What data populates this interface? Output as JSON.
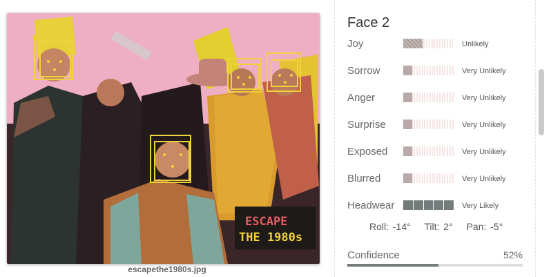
{
  "image": {
    "filename": "escapethe1980s.jpg",
    "sign": {
      "line1": "ESCAPE",
      "line2": "THE 1980s"
    }
  },
  "face": {
    "title": "Face 2",
    "attributes": [
      {
        "label": "Joy",
        "value": "Unlikely",
        "level": 1,
        "max": 5,
        "style": "filled-pattern"
      },
      {
        "label": "Sorrow",
        "value": "Very Unlikely",
        "level": 0.2,
        "max": 5,
        "style": "filled"
      },
      {
        "label": "Anger",
        "value": "Very Unlikely",
        "level": 0.2,
        "max": 5,
        "style": "filled"
      },
      {
        "label": "Surprise",
        "value": "Very Unlikely",
        "level": 0.2,
        "max": 5,
        "style": "filled"
      },
      {
        "label": "Exposed",
        "value": "Very Unlikely",
        "level": 0.2,
        "max": 5,
        "style": "filled"
      },
      {
        "label": "Blurred",
        "value": "Very Unlikely",
        "level": 0.2,
        "max": 5,
        "style": "filled"
      },
      {
        "label": "Headwear",
        "value": "Very Likely",
        "level": 5,
        "max": 5,
        "style": "strong"
      }
    ],
    "pose": {
      "roll": "Roll: -14°",
      "tilt": "Tilt: 2°",
      "pan": "Pan: -5°"
    },
    "confidence": {
      "label": "Confidence",
      "value": "52%",
      "fraction": 0.52
    }
  },
  "colors": {
    "accent_bar": "#737c7b",
    "light_bar": "#b9aaa9",
    "face_box": "#f2d23a"
  },
  "icons": [
    "scrollbar-thumb"
  ]
}
